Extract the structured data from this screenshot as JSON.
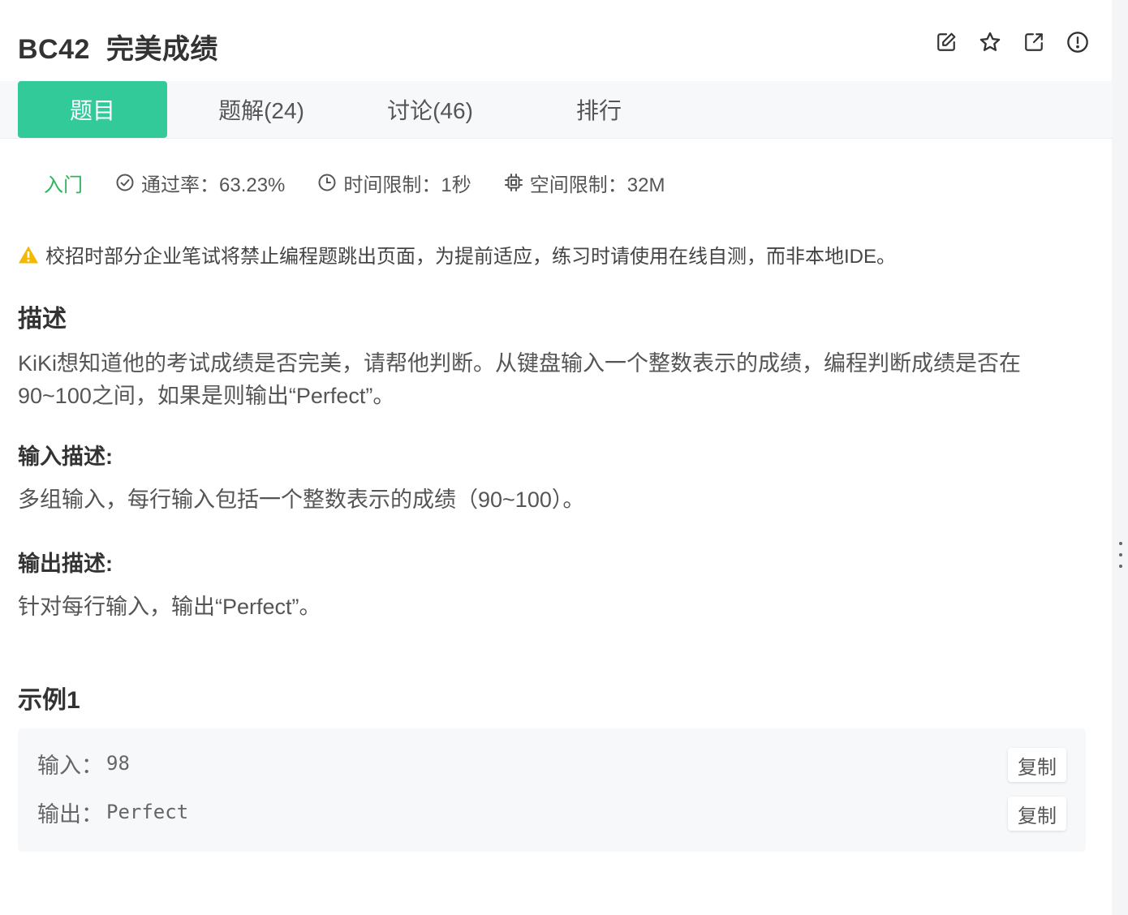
{
  "problem": {
    "code": "BC42",
    "title": "完美成绩"
  },
  "header_actions": {
    "icons": [
      "edit-icon",
      "star-icon",
      "share-icon",
      "report-icon"
    ]
  },
  "tabs": [
    {
      "label": "题目",
      "active": true
    },
    {
      "label": "题解(24)",
      "active": false
    },
    {
      "label": "讨论(46)",
      "active": false
    },
    {
      "label": "排行",
      "active": false
    }
  ],
  "meta": {
    "level": "入门",
    "pass_rate": "通过率：63.23%",
    "time_limit": "时间限制：1秒",
    "space_limit": "空间限制：32M"
  },
  "notice": "校招时部分企业笔试将禁止编程题跳出页面，为提前适应，练习时请使用在线自测，而非本地IDE。",
  "description": {
    "title": "描述",
    "text_line1": "KiKi想知道他的考试成绩是否完美，请帮他判断。从键盘输入一个整数表示的成绩，编程判断成绩是否在",
    "text_line2": "90~100之间，如果是则输出“Perfect”。"
  },
  "input_desc": {
    "title": "输入描述:",
    "text": "多组输入，每行输入包括一个整数表示的成绩（90~100）。"
  },
  "output_desc": {
    "title": "输出描述:",
    "text": "针对每行输入，输出“Perfect”。"
  },
  "example": {
    "title": "示例1",
    "input_label": "输入：",
    "input_value": "98",
    "output_label": "输出：",
    "output_value": "Perfect",
    "copy_label": "复制"
  },
  "colors": {
    "accent": "#32ca99",
    "level": "#2db55d",
    "warning": "#f5b800"
  }
}
